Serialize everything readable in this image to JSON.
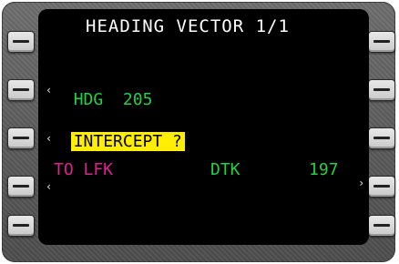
{
  "screen": {
    "title": "HEADING VECTOR 1/1",
    "line1": {
      "label": "HDG",
      "value": "205"
    },
    "line2": {
      "label": "INTERCEPT ?"
    },
    "line3": {
      "label": "TO LFK",
      "dtk_label": "DTK",
      "dtk_value": "197"
    },
    "caret_left": "‹",
    "caret_right": "›"
  },
  "colors": {
    "green": "#22d243",
    "magenta": "#e0208f",
    "highlight": "#ffee00",
    "white": "#ffffff"
  }
}
